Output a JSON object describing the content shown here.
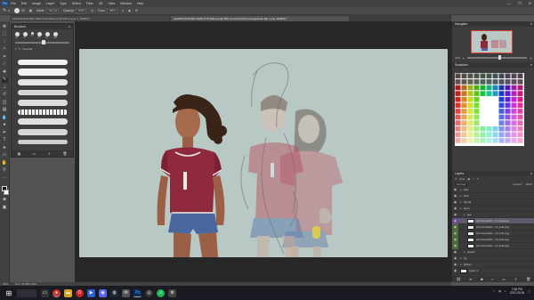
{
  "menubar": {
    "logo": "Ps",
    "items": [
      "File",
      "Edit",
      "Image",
      "Layer",
      "Type",
      "Select",
      "Filter",
      "3D",
      "View",
      "Window",
      "Help"
    ]
  },
  "options": {
    "size": "35",
    "mode_label": "Mode:",
    "mode_value": "Normal",
    "opacity_label": "Opacity:",
    "opacity_value": "100%",
    "flow_label": "Flow:",
    "flow_value": "100%"
  },
  "tabs": [
    {
      "label": "CHARIS RHONDA NEW FUTURE.psd @ 50% (Layer 1, RGB/8) *",
      "active": false
    },
    {
      "label": "CHARIS RHONDA NEW FUTURE.psd @ 50% (armin/mesh/memo/type/cite.fab 1.png, RGB/8) *",
      "active": true
    }
  ],
  "brushes": {
    "title": "Brushes",
    "preset_sizes": [
      "30",
      "70",
      "12",
      "25",
      "70",
      "100"
    ],
    "folder": "General"
  },
  "navigator": {
    "title": "Navigator",
    "zoom": "33%"
  },
  "swatches": {
    "title": "Swatches"
  },
  "layers": {
    "title": "Layers",
    "kind_label": "Kind",
    "blend": "Normal",
    "opacity_label": "Opacity:",
    "opacity_value": "100%",
    "rows": [
      {
        "name": "skin",
        "indent": 0,
        "folder": true,
        "tag": ""
      },
      {
        "name": "shirt",
        "indent": 0,
        "folder": true,
        "tag": ""
      },
      {
        "name": "shorts",
        "indent": 0,
        "folder": true,
        "tag": ""
      },
      {
        "name": "arms",
        "indent": 0,
        "folder": true,
        "tag": ""
      },
      {
        "name": "gun",
        "indent": 1,
        "folder": true,
        "tag": ""
      },
      {
        "name": "armin/mesh/m...cr_bod.png",
        "indent": 2,
        "folder": false,
        "tag": "purple",
        "selected": true
      },
      {
        "name": "armin/mesh/m...cit_bod.png",
        "indent": 2,
        "folder": false,
        "tag": "green"
      },
      {
        "name": "armin/mesh/m...cit_bod.png",
        "indent": 2,
        "folder": false,
        "tag": "green"
      },
      {
        "name": "armin/mesh/m...cit_bod.png",
        "indent": 2,
        "folder": false,
        "tag": "green"
      },
      {
        "name": "armin/mesh/m...cit_bod.png",
        "indent": 2,
        "folder": false,
        "tag": "green"
      },
      {
        "name": "sketch",
        "indent": 1,
        "folder": true,
        "tag": ""
      },
      {
        "name": "bg",
        "indent": 0,
        "folder": true,
        "tag": ""
      },
      {
        "name": "lighten",
        "indent": 0,
        "folder": true,
        "tag": ""
      },
      {
        "name": "Layer 1",
        "indent": 0,
        "folder": false,
        "tag": ""
      }
    ]
  },
  "status": {
    "zoom": "33%",
    "doc": "Doc: 40.9M/1.46G"
  },
  "taskbar": {
    "time": "2:56 PM",
    "date": "2022-09-06"
  }
}
